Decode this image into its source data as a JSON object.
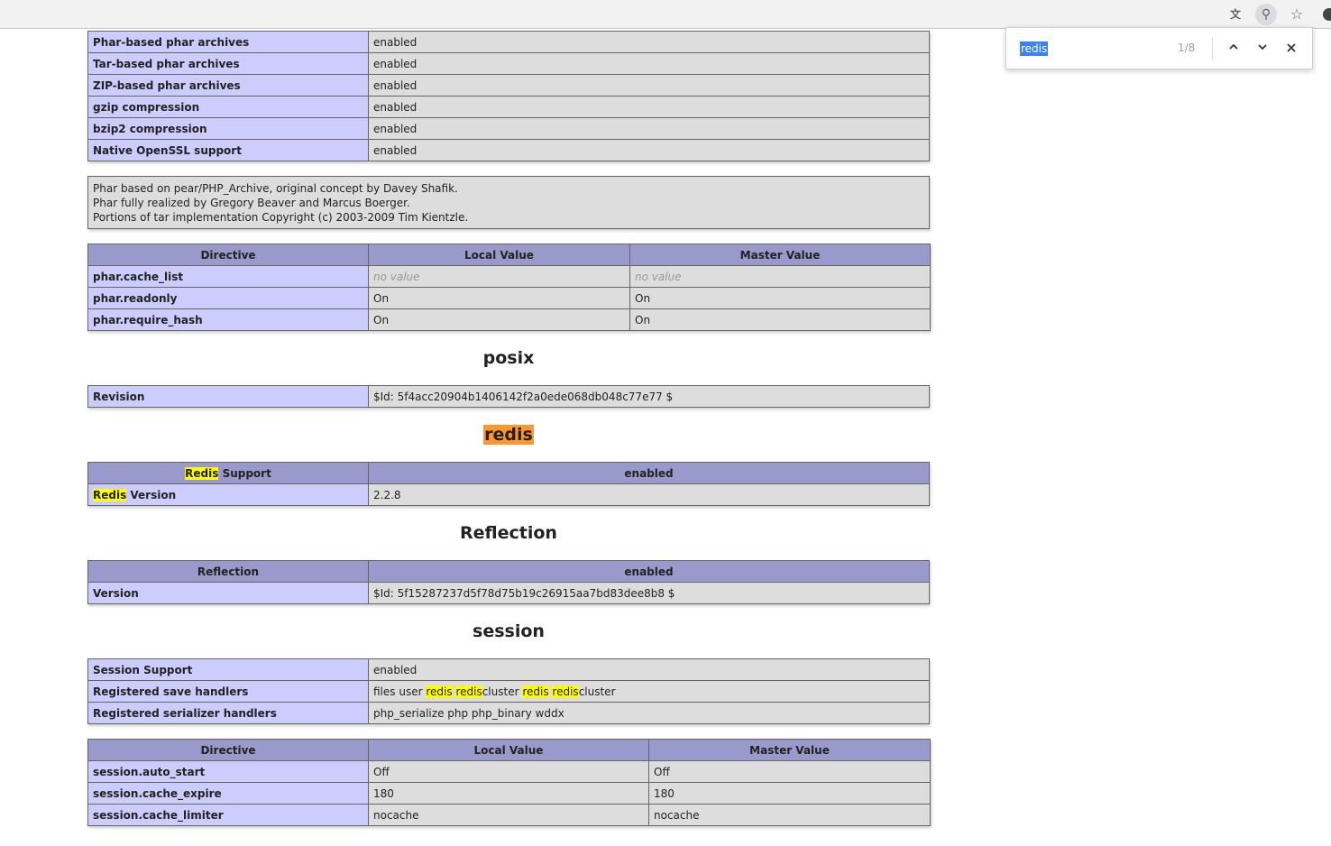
{
  "findbar": {
    "query": "redis",
    "count": "1/8",
    "prev_icon": "chevron-up-icon",
    "next_icon": "chevron-down-icon",
    "close_icon": "close-icon"
  },
  "phar": {
    "features": [
      {
        "name": "Phar-based phar archives",
        "value": "enabled"
      },
      {
        "name": "Tar-based phar archives",
        "value": "enabled"
      },
      {
        "name": "ZIP-based phar archives",
        "value": "enabled"
      },
      {
        "name": "gzip compression",
        "value": "enabled"
      },
      {
        "name": "bzip2 compression",
        "value": "enabled"
      },
      {
        "name": "Native OpenSSL support",
        "value": "enabled"
      }
    ],
    "credits": [
      "Phar based on pear/PHP_Archive, original concept by Davey Shafik.",
      "Phar fully realized by Gregory Beaver and Marcus Boerger.",
      "Portions of tar implementation Copyright (c) 2003-2009 Tim Kientzle."
    ],
    "directive_headers": [
      "Directive",
      "Local Value",
      "Master Value"
    ],
    "directives": [
      {
        "name": "phar.cache_list",
        "local": "no value",
        "master": "no value"
      },
      {
        "name": "phar.readonly",
        "local": "On",
        "master": "On"
      },
      {
        "name": "phar.require_hash",
        "local": "On",
        "master": "On"
      }
    ]
  },
  "posix": {
    "title": "posix",
    "revision_label": "Revision",
    "revision_value": "$Id: 5f4acc20904b1406142f2a0ede068db048c77e77 $"
  },
  "redis": {
    "title": "redis",
    "support_hl": "Redis",
    "support_rest": " Support",
    "support_value": "enabled",
    "version_hl": "Redis",
    "version_rest": " Version",
    "version_value": "2.2.8"
  },
  "reflection": {
    "title": "Reflection",
    "header_name": "Reflection",
    "header_value": "enabled",
    "version_label": "Version",
    "version_value": "$Id: 5f15287237d5f78d75b19c26915aa7bd83dee8b8 $"
  },
  "session": {
    "title": "session",
    "support_label": "Session Support",
    "support_value": "enabled",
    "save_handlers_label": "Registered save handlers",
    "save_handlers_parts": [
      "files user ",
      "redis",
      " ",
      "redis",
      "cluster ",
      "redis",
      " ",
      "redis",
      "cluster"
    ],
    "serializer_label": "Registered serializer handlers",
    "serializer_value": "php_serialize php php_binary wddx",
    "directive_headers": [
      "Directive",
      "Local Value",
      "Master Value"
    ],
    "directives": [
      {
        "name": "session.auto_start",
        "local": "Off",
        "master": "Off"
      },
      {
        "name": "session.cache_expire",
        "local": "180",
        "master": "180"
      },
      {
        "name": "session.cache_limiter",
        "local": "nocache",
        "master": "nocache"
      }
    ]
  },
  "colors": {
    "header": "#9999cc",
    "key_cell": "#ccccff",
    "value_cell": "#dddddd",
    "match": "#ffff00",
    "active_match": "#ff9632"
  }
}
